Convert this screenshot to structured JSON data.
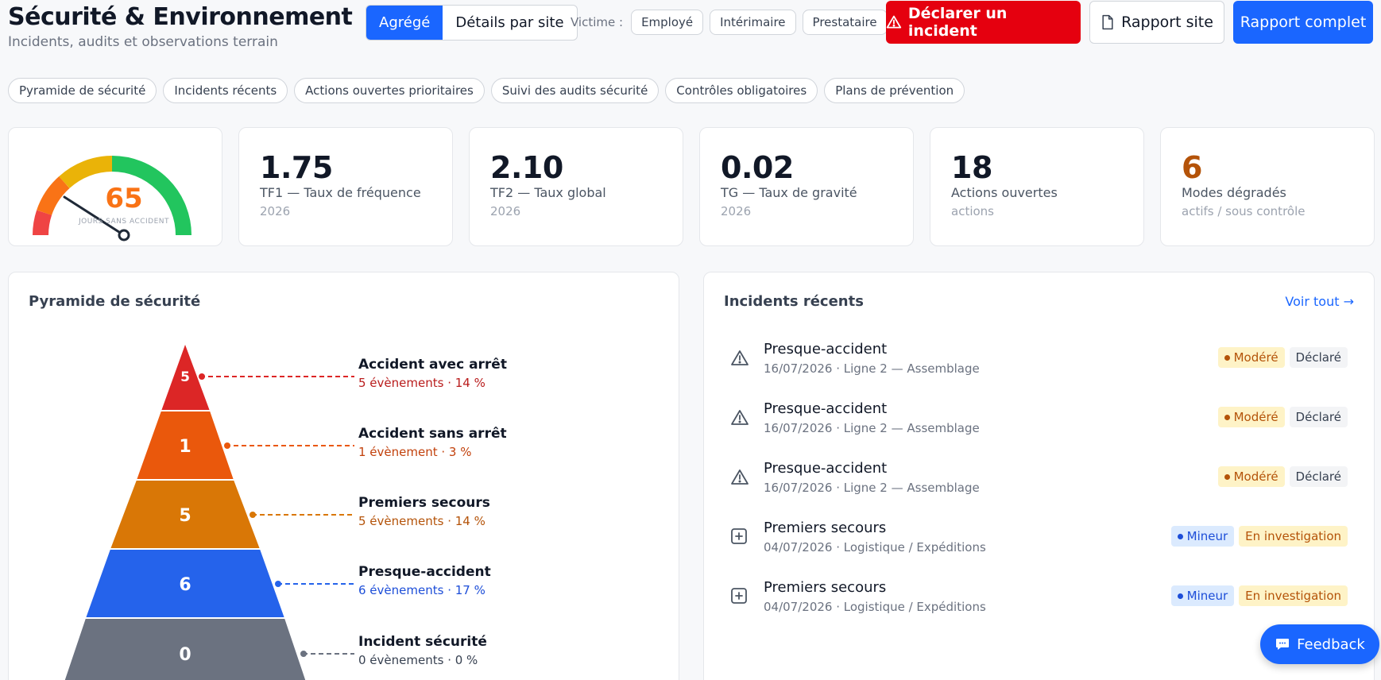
{
  "header": {
    "title": "Sécurité & Environnement",
    "subtitle": "Incidents, audits et observations terrain"
  },
  "view_toggle": {
    "active": "Agrégé",
    "inactive": "Détails par site"
  },
  "victim_filter": {
    "label": "Victime :",
    "options": [
      "Employé",
      "Intérimaire",
      "Prestataire"
    ]
  },
  "actions": {
    "declare": "Déclarer un incident",
    "site_report": "Rapport site",
    "full_report": "Rapport complet"
  },
  "chips": [
    "Pyramide de sécurité",
    "Incidents récents",
    "Actions ouvertes prioritaires",
    "Suivi des audits sécurité",
    "Contrôles obligatoires",
    "Plans de prévention"
  ],
  "gauge": {
    "value": "65",
    "label": "JOURS SANS ACCIDENT"
  },
  "kpis": [
    {
      "value": "1.75",
      "label": "TF1 — Taux de fréquence",
      "period": "2026",
      "color": "#111827"
    },
    {
      "value": "2.10",
      "label": "TF2 — Taux global",
      "period": "2026",
      "color": "#111827"
    },
    {
      "value": "0.02",
      "label": "TG — Taux de gravité",
      "period": "2026",
      "color": "#111827"
    },
    {
      "value": "18",
      "label": "Actions ouvertes",
      "period": "actions",
      "color": "#111827"
    },
    {
      "value": "6",
      "label": "Modes dégradés",
      "period": "actifs / sous contrôle",
      "color": "#b45309"
    }
  ],
  "pyramid": {
    "title": "Pyramide de sécurité",
    "levels": [
      {
        "count": "5",
        "name": "Accident avec arrêt",
        "detail": "5 évènements · 14 %",
        "color": "#dc2626",
        "text": "#b91c1c"
      },
      {
        "count": "1",
        "name": "Accident sans arrêt",
        "detail": "1 évènement · 3 %",
        "color": "#ea580c",
        "text": "#c2410c"
      },
      {
        "count": "5",
        "name": "Premiers secours",
        "detail": "5 évènements · 14 %",
        "color": "#d97706",
        "text": "#b45309"
      },
      {
        "count": "6",
        "name": "Presque-accident",
        "detail": "6 évènements · 17 %",
        "color": "#2563eb",
        "text": "#1d4ed8"
      },
      {
        "count": "0",
        "name": "Incident sécurité",
        "detail": "0 évènements · 0 %",
        "color": "#6b7280",
        "text": "#374151"
      }
    ]
  },
  "incidents": {
    "title": "Incidents récents",
    "view_all": "Voir tout →",
    "items": [
      {
        "icon": "warning-icon",
        "title": "Presque-accident",
        "meta": "16/07/2026 · Ligne 2 — Assemblage",
        "severity": "Modéré",
        "status": "Déclaré"
      },
      {
        "icon": "warning-icon",
        "title": "Presque-accident",
        "meta": "16/07/2026 · Ligne 2 — Assemblage",
        "severity": "Modéré",
        "status": "Déclaré"
      },
      {
        "icon": "warning-icon",
        "title": "Presque-accident",
        "meta": "16/07/2026 · Ligne 2 — Assemblage",
        "severity": "Modéré",
        "status": "Déclaré"
      },
      {
        "icon": "first-aid-icon",
        "title": "Premiers secours",
        "meta": "04/07/2026 · Logistique / Expéditions",
        "severity": "Mineur",
        "status": "En investigation"
      },
      {
        "icon": "first-aid-icon",
        "title": "Premiers secours",
        "meta": "04/07/2026 · Logistique / Expéditions",
        "severity": "Mineur",
        "status": "En investigation"
      }
    ]
  },
  "feedback": "Feedback"
}
